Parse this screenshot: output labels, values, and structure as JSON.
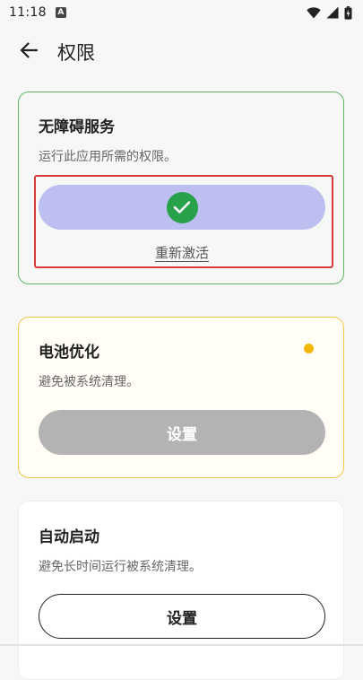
{
  "status_bar": {
    "time": "11:18",
    "notification_icon_letter": "A",
    "wifi_icon": "wifi-icon",
    "signal_icon": "signal-icon",
    "battery_icon": "battery-icon"
  },
  "app_bar": {
    "back_icon": "arrow-left-icon",
    "title": "权限"
  },
  "cards": {
    "accessibility": {
      "title": "无障碍服务",
      "description": "运行此应用所需的权限。",
      "status_icon": "checkmark-icon",
      "action_label": "重新激活",
      "border_color": "#62b566"
    },
    "battery": {
      "title": "电池优化",
      "description": "避免被系统清理。",
      "button_label": "设置",
      "status_color": "#f2b700",
      "border_color": "#f2c84b"
    },
    "autostart": {
      "title": "自动启动",
      "description": "避免长时间运行被系统清理。",
      "button_label": "设置"
    }
  },
  "colors": {
    "activated_pill": "#bdbff0",
    "check_green": "#27a24a",
    "highlight_red": "#d63a3a",
    "disabled_button": "#b3b3b3"
  }
}
